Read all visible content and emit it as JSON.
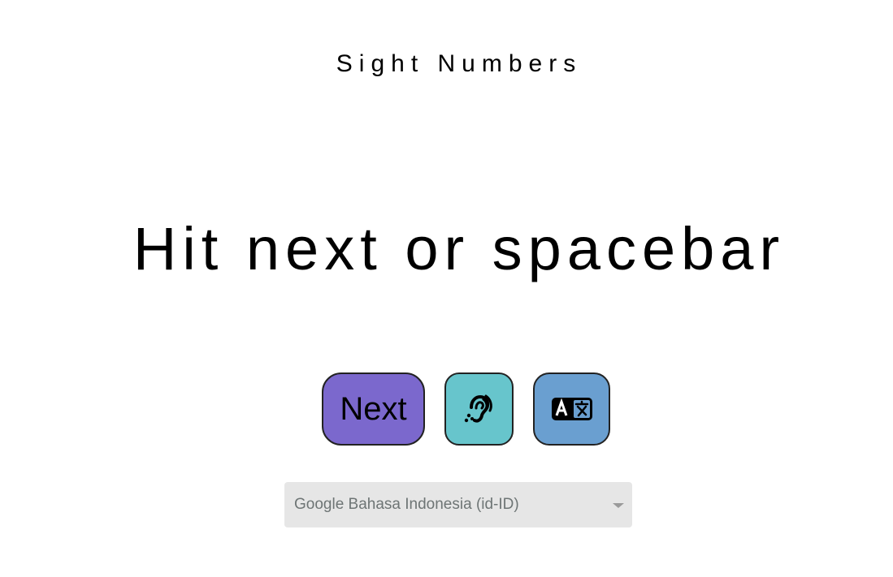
{
  "title": "Sight Numbers",
  "prompt": "Hit next or spacebar",
  "buttons": {
    "next_label": "Next",
    "hear_icon": "ear-listen-icon",
    "translate_icon": "translate-icon"
  },
  "voice_select": {
    "selected": "Google Bahasa Indonesia (id-ID)"
  },
  "colors": {
    "next_button": "#7b68cd",
    "hear_button": "#67c5cc",
    "translate_button": "#6a9fd0",
    "select_background": "#e6e6e6"
  }
}
